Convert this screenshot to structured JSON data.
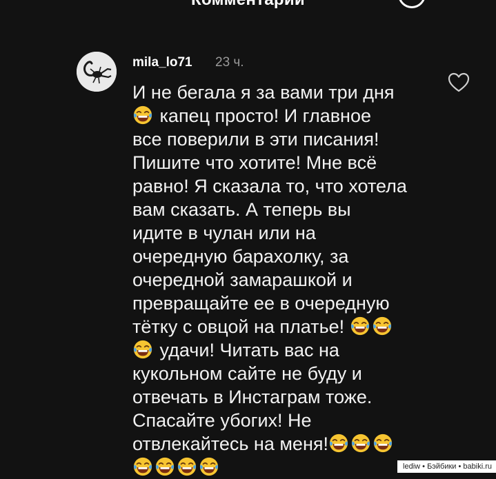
{
  "header": {
    "title": "Комментарии"
  },
  "comment": {
    "username": "mila_lo71",
    "time": "23 ч.",
    "lines": [
      "И не бегала я за вами три дня",
      "капец просто! И главное",
      "все поверили в эти писания!",
      "Пишите что хотите! Мне всё",
      "равно! Я сказала то, что хотела",
      "вам сказать. А теперь вы",
      "идите в чулан или на",
      "очередную барахолку, за",
      "очередной замарашкой и",
      "превращайте ее в очередную",
      "тётку с овцой на платье!",
      "удачи! Читать вас на",
      "кукольном сайте не буду и",
      "отвечать в Инстаграм тоже.",
      "Спасайте убогих! Не",
      "отвлекайтесь на меня!"
    ]
  },
  "watermark": "lediw • Бэйбики • babiki.ru",
  "icons": {
    "avatar": "scorpion-avatar",
    "heart": "heart-outline-icon",
    "emoji": "face-with-tears-of-joy-emoji"
  },
  "colors": {
    "background": "#121212",
    "text": "#f2f2f2",
    "muted": "#9a9a9a",
    "emoji_yellow": "#f7c531"
  }
}
